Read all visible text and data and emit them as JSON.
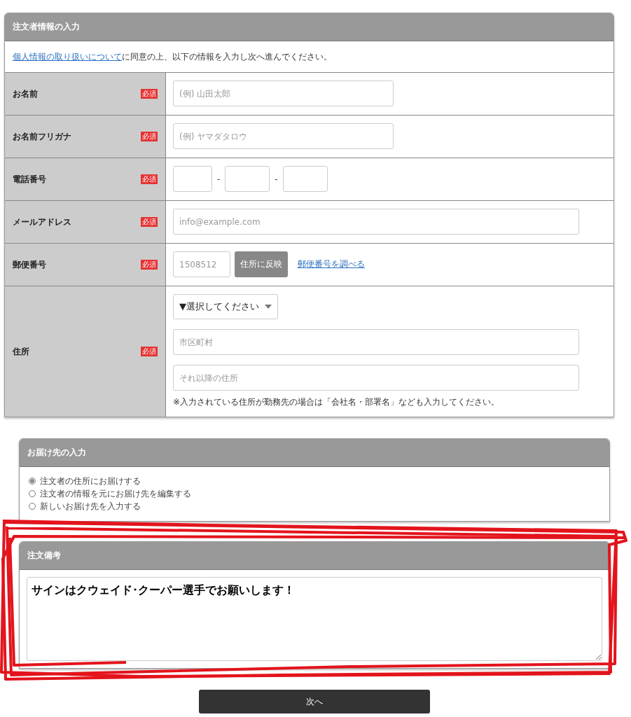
{
  "orderer": {
    "title": "注文者情報の入力",
    "intro": {
      "link": "個人情報の取り扱いについて",
      "text": "に同意の上、以下の情報を入力し次へ進んでください。"
    },
    "rows": [
      {
        "label": "お名前",
        "badge": "必須",
        "kind": "text",
        "fields": [
          {
            "placeholder": "(例) 山田太郎"
          }
        ]
      },
      {
        "label": "お名前フリガナ",
        "badge": "必須",
        "kind": "text",
        "fields": [
          {
            "placeholder": "(例) ヤマダタロウ"
          }
        ]
      },
      {
        "label": "電話番号",
        "badge": "必須",
        "kind": "phone",
        "separators": [
          "-",
          "-"
        ]
      },
      {
        "label": "メールアドレス",
        "badge": "必須",
        "kind": "text",
        "fields": [
          {
            "placeholder": "info@example.com"
          }
        ]
      },
      {
        "label": "郵便番号",
        "badge": "必須",
        "kind": "postal",
        "fields": [
          {
            "placeholder": "1508512"
          }
        ],
        "button": "住所に反映",
        "link": "郵便番号を調べる"
      },
      {
        "label": "住所",
        "badge": "必須",
        "kind": "address",
        "select": "▼選択してください",
        "fields": [
          {
            "placeholder": "市区町村"
          },
          {
            "placeholder": "それ以降の住所"
          }
        ],
        "note": "※入力されている住所が勤務先の場合は「会社名・部署名」なども入力してください。"
      }
    ]
  },
  "delivery": {
    "title": "お届け先の入力",
    "options": [
      {
        "label": "注文者の住所にお届けする",
        "selected": true
      },
      {
        "label": "注文者の情報を元にお届け先を編集する",
        "selected": false
      },
      {
        "label": "新しいお届け先を入力する",
        "selected": false
      }
    ]
  },
  "notes": {
    "title": "注文備考",
    "value": "サインはクウェイド･クーパー選手でお願いします！"
  },
  "next_button": "次へ",
  "annotation": {
    "kind": "scribble"
  }
}
